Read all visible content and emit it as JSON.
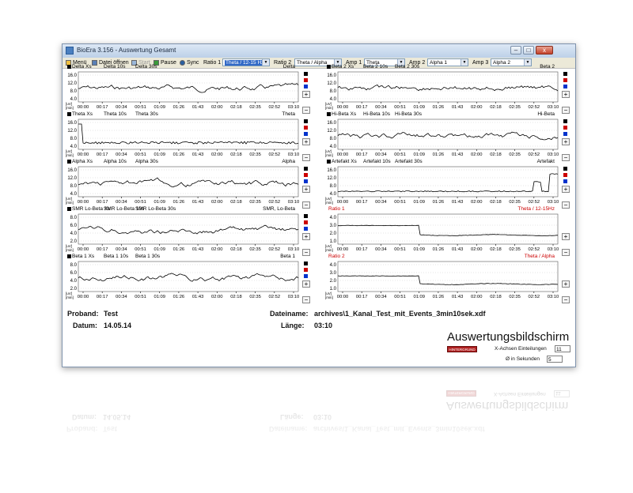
{
  "window": {
    "title": "BioEra 3.156 - Auswertung Gesamt"
  },
  "toolbar": {
    "menu": "Menü",
    "open": "Datei öffnen",
    "start": "Start",
    "pause": "Pause",
    "sync": "Sync",
    "ratio1_label": "Ratio 1",
    "ratio1_value": "Theta / 12-15 Hz",
    "ratio2_label": "Ratio 2",
    "ratio2_value": "Theta / Alpha",
    "amp1_label": "Amp 1",
    "amp1_value": "Theta",
    "amp2_label": "Amp 2",
    "amp2_value": "Alpha 1",
    "amp3_label": "Amp 3",
    "amp3_value": "Alpha 2"
  },
  "colors": {
    "titlebar": "#c9d8ec",
    "accent_red": "#cc0000",
    "plot_line": "#000000",
    "select_highlight": "#3169c6"
  },
  "time_ticks": [
    "00:00",
    "00:17",
    "00:34",
    "00:51",
    "01:09",
    "01:26",
    "01:43",
    "02:00",
    "02:18",
    "02:35",
    "02:52",
    "03:10"
  ],
  "axis_units": {
    "y": "[uV]",
    "x": "[min]"
  },
  "left_panels": [
    {
      "legend": [
        "Delta Xs",
        "Delta 10s",
        "Delta 30s"
      ],
      "label": "Delta",
      "yticks": [
        "16.0",
        "12.0",
        "8.0",
        "4.0"
      ],
      "ymax": 16
    },
    {
      "legend": [
        "Theta Xs",
        "Theta 10s",
        "Theta 30s"
      ],
      "label": "Theta",
      "yticks": [
        "16.0",
        "12.0",
        "8.0",
        "4.0"
      ],
      "ymax": 16
    },
    {
      "legend": [
        "Alpha Xs",
        "Alpha 10s",
        "Alpha 30s"
      ],
      "label": "Alpha",
      "yticks": [
        "16.0",
        "12.0",
        "8.0",
        "4.0"
      ],
      "ymax": 16
    },
    {
      "legend": [
        "SMR Lo-Beta Xs",
        "SMR Lo-Beta 10s",
        "SMR Lo-Beta 30s"
      ],
      "label": "SMR, Lo-Beta",
      "yticks": [
        "8.0",
        "6.0",
        "4.0",
        "2.0"
      ],
      "ymax": 8
    },
    {
      "legend": [
        "Beta 1 Xs",
        "Beta 1 10s",
        "Beta 1 30s"
      ],
      "label": "Beta 1",
      "yticks": [
        "8.0",
        "6.0",
        "4.0",
        "2.0"
      ],
      "ymax": 8
    }
  ],
  "right_panels": [
    {
      "legend": [
        "Beta 2 Xs",
        "Beta 2 10s",
        "Beta 2 30s"
      ],
      "label": "Beta 2",
      "yticks": [
        "16.0",
        "12.0",
        "8.0",
        "4.0"
      ],
      "ymax": 16,
      "red": false
    },
    {
      "legend": [
        "Hi-Beta Xs",
        "Hi-Beta 10s",
        "Hi-Beta 30s"
      ],
      "label": "Hi-Beta",
      "yticks": [
        "16.0",
        "12.0",
        "8.0",
        "4.0"
      ],
      "ymax": 16,
      "red": false
    },
    {
      "legend": [
        "Artefakt Xs",
        "Artefakt 10s",
        "Artefakt 30s"
      ],
      "label": "Artefakt",
      "yticks": [
        "16.0",
        "12.0",
        "8.0",
        "4.0"
      ],
      "ymax": 16,
      "red": false
    },
    {
      "legend": [
        "Ratio 1"
      ],
      "label": "Theta / 12-15Hz",
      "yticks": [
        "4.0",
        "3.0",
        "2.0",
        "1.0"
      ],
      "ymax": 4,
      "red": true
    },
    {
      "legend": [
        "Ratio 2"
      ],
      "label": "Theta / Alpha",
      "yticks": [
        "4.0",
        "3.0",
        "2.0",
        "1.0"
      ],
      "ymax": 4,
      "red": true
    }
  ],
  "info": {
    "proband_label": "Proband:",
    "proband_value": "Test",
    "datum_label": "Datum:",
    "datum_value": "14.05.14",
    "dateiname_label": "Dateiname:",
    "dateiname_value": "archives\\1_Kanal_Test_mit_Events_3min10sek.xdf",
    "laenge_label": "Länge:",
    "laenge_value": "03:10"
  },
  "footer": {
    "title": "Auswertungsbildschirm",
    "hintergrund": "HINTERGRUND",
    "xaxis_label": "X-Achsen Einteilungen",
    "xaxis_value": "11",
    "avg_label": "Ø in Sekunden",
    "avg_value": "5"
  }
}
